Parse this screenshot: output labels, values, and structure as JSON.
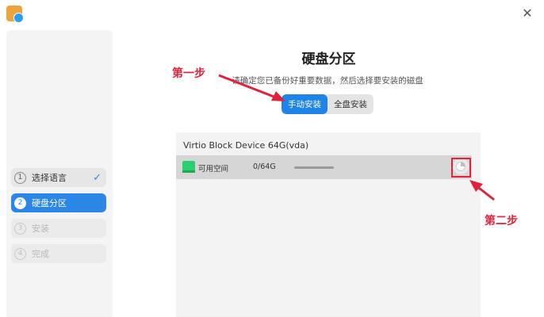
{
  "window": {
    "app_icon": "installer-app-icon",
    "close_icon": "close-icon"
  },
  "sidebar": {
    "steps": [
      {
        "num": "1",
        "label": "选择语言",
        "state": "done"
      },
      {
        "num": "2",
        "label": "硬盘分区",
        "state": "active"
      },
      {
        "num": "3",
        "label": "安装",
        "state": "todo"
      },
      {
        "num": "4",
        "label": "完成",
        "state": "todo"
      }
    ],
    "check_icon": "checkmark-icon"
  },
  "main": {
    "title": "硬盘分区",
    "subtitle": "请确定您已备份好重要数据，然后选择要安装的磁盘",
    "modes": [
      {
        "label": "手动安装",
        "selected": true
      },
      {
        "label": "全盘安装",
        "selected": false
      }
    ],
    "device": {
      "name": "Virtio Block Device 64G(vda)",
      "partition": {
        "name": "可用空间",
        "size": "0/64G",
        "edit_icon": "pie-chart-icon"
      }
    }
  },
  "annotations": {
    "step1": "第一步",
    "step2": "第二步",
    "color": "#e3213a"
  },
  "colors": {
    "accent": "#1f84e8",
    "free_space": "#2bd06e"
  }
}
